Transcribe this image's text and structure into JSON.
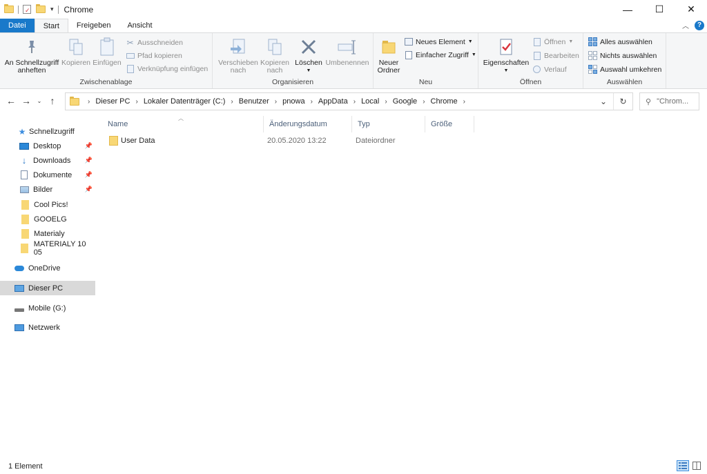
{
  "window": {
    "title": "Chrome"
  },
  "controls": {
    "minimize": "—",
    "maximize": "☐",
    "close": "✕"
  },
  "tabs": [
    {
      "label": "Datei"
    },
    {
      "label": "Start"
    },
    {
      "label": "Freigeben"
    },
    {
      "label": "Ansicht"
    }
  ],
  "ribbon": {
    "clipboard": {
      "pin_label_1": "An Schnellzugriff",
      "pin_label_2": "anheften",
      "copy": "Kopieren",
      "paste": "Einfügen",
      "cut": "Ausschneiden",
      "copy_path": "Pfad kopieren",
      "paste_shortcut": "Verknüpfung einfügen",
      "group": "Zwischenablage"
    },
    "organize": {
      "move_1": "Verschieben",
      "move_2": "nach",
      "copyto_1": "Kopieren",
      "copyto_2": "nach",
      "delete": "Löschen",
      "rename": "Umbenennen",
      "group": "Organisieren"
    },
    "new": {
      "new_folder_1": "Neuer",
      "new_folder_2": "Ordner",
      "new_item": "Neues Element",
      "easy_access": "Einfacher Zugriff",
      "group": "Neu"
    },
    "open": {
      "properties": "Eigenschaften",
      "open": "Öffnen",
      "edit": "Bearbeiten",
      "history": "Verlauf",
      "group": "Öffnen"
    },
    "select": {
      "select_all": "Alles auswählen",
      "select_none": "Nichts auswählen",
      "invert": "Auswahl umkehren",
      "group": "Auswählen"
    }
  },
  "address": {
    "crumbs": [
      "Dieser PC",
      "Lokaler Datenträger (C:)",
      "Benutzer",
      "pnowa",
      "AppData",
      "Local",
      "Google",
      "Chrome"
    ],
    "search_placeholder": "\"Chrom..."
  },
  "navpane": {
    "quick_access": "Schnellzugriff",
    "items": [
      {
        "label": "Desktop",
        "pinned": true
      },
      {
        "label": "Downloads",
        "pinned": true
      },
      {
        "label": "Dokumente",
        "pinned": true
      },
      {
        "label": "Bilder",
        "pinned": true
      },
      {
        "label": "Cool Pics!",
        "pinned": false
      },
      {
        "label": "GOOELG",
        "pinned": false
      },
      {
        "label": "Materialy",
        "pinned": false
      },
      {
        "label": "MATERIALY 10 05",
        "pinned": false
      }
    ],
    "onedrive": "OneDrive",
    "this_pc": "Dieser PC",
    "mobile": "Mobile (G:)",
    "network": "Netzwerk"
  },
  "columns": [
    "Name",
    "Änderungsdatum",
    "Typ",
    "Größe"
  ],
  "files": [
    {
      "name": "User Data",
      "date": "20.05.2020 13:22",
      "type": "Dateiordner",
      "size": ""
    }
  ],
  "status": {
    "count": "1 Element"
  }
}
